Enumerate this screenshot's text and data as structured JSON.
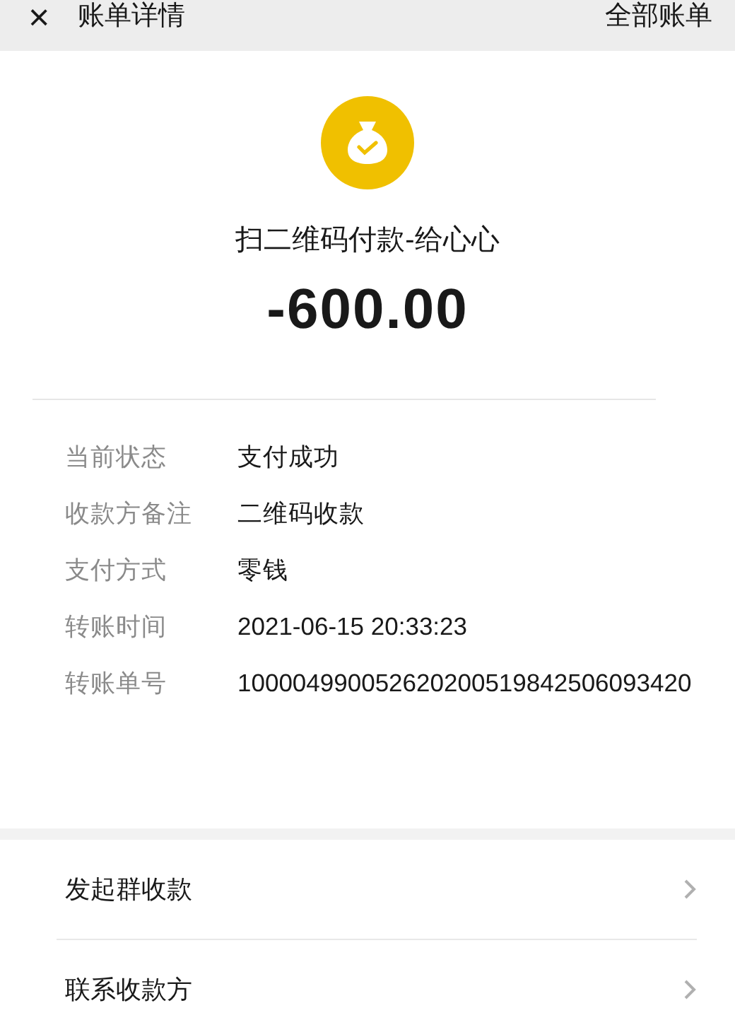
{
  "header": {
    "close": "×",
    "title": "账单详情",
    "action": "全部账单"
  },
  "summary": {
    "title": "扫二维码付款-给心心",
    "amount": "-600.00"
  },
  "details": [
    {
      "label": "当前状态",
      "value": "支付成功"
    },
    {
      "label": "收款方备注",
      "value": "二维码收款"
    },
    {
      "label": "支付方式",
      "value": "零钱"
    },
    {
      "label": "转账时间",
      "value": "2021-06-15 20:33:23"
    },
    {
      "label": "转账单号",
      "value": "100004990052620200519842506093420"
    }
  ],
  "links": [
    {
      "label": "发起群收款"
    },
    {
      "label": "联系收款方"
    }
  ]
}
